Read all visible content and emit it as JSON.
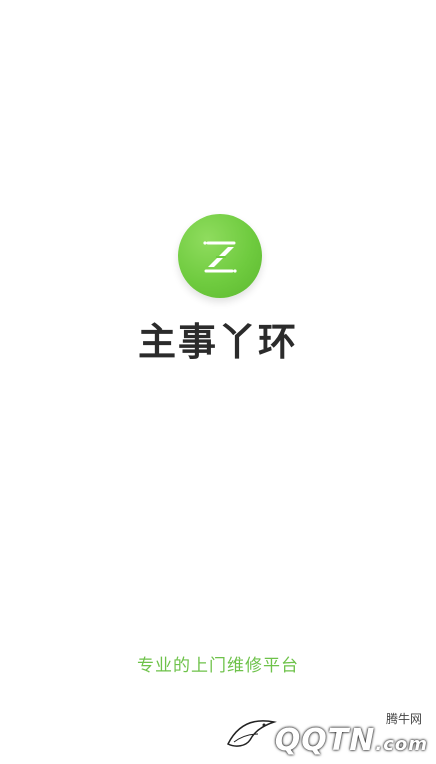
{
  "splash": {
    "app_name": "主事丫环",
    "tagline": "专业的上门维修平台",
    "logo_icon": "z-logo-icon",
    "logo_color": "#6fcb3f",
    "tagline_color": "#6ec24a"
  },
  "watermark": {
    "small_text": "腾牛网",
    "main_text": "QQTN",
    "suffix": ".com",
    "icon": "bird-icon"
  }
}
